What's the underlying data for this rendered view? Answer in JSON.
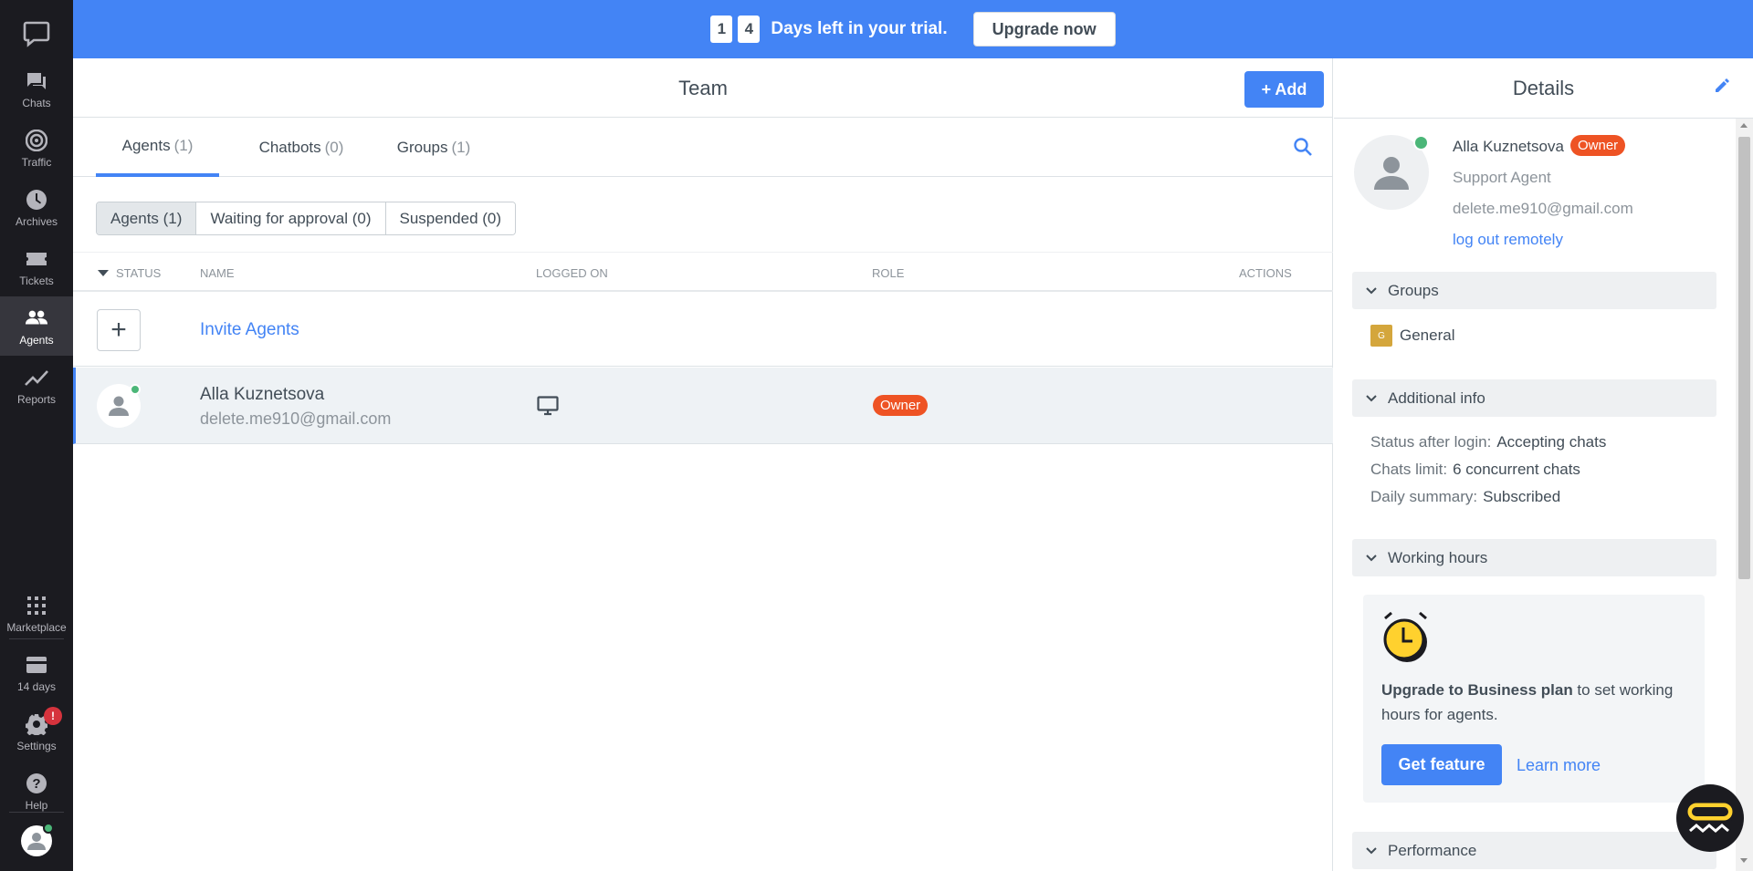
{
  "nav": {
    "items": [
      {
        "label": "Chats",
        "icon": "chat-icon"
      },
      {
        "label": "Traffic",
        "icon": "traffic-icon"
      },
      {
        "label": "Archives",
        "icon": "clock-icon"
      },
      {
        "label": "Tickets",
        "icon": "ticket-icon"
      },
      {
        "label": "Agents",
        "icon": "agents-icon",
        "active": true
      },
      {
        "label": "Reports",
        "icon": "chart-icon"
      }
    ],
    "bottom": [
      {
        "label": "Marketplace",
        "icon": "grid-icon"
      },
      {
        "label": "14 days",
        "icon": "card-icon"
      },
      {
        "label": "Settings",
        "icon": "gear-icon",
        "badge": "!"
      },
      {
        "label": "Help",
        "icon": "help-icon"
      }
    ]
  },
  "banner": {
    "digits": [
      "1",
      "4"
    ],
    "text": "Days left in your trial.",
    "button": "Upgrade now"
  },
  "main": {
    "title": "Team",
    "add_button": "+ Add",
    "tabs": [
      {
        "label": "Agents",
        "count": "(1)",
        "active": true
      },
      {
        "label": "Chatbots",
        "count": "(0)"
      },
      {
        "label": "Groups",
        "count": "(1)"
      }
    ],
    "segments": [
      "Agents (1)",
      "Waiting for approval (0)",
      "Suspended (0)"
    ],
    "columns": [
      "Status",
      "Name",
      "Logged on",
      "Role",
      "Actions"
    ],
    "invite_label": "Invite Agents",
    "agent": {
      "name": "Alla Kuznetsova",
      "email": "delete.me910@gmail.com",
      "role": "Owner"
    }
  },
  "details": {
    "title": "Details",
    "name": "Alla Kuznetsova",
    "badge": "Owner",
    "role": "Support Agent",
    "email": "delete.me910@gmail.com",
    "logout": "log out remotely",
    "sections": {
      "groups": "Groups",
      "additional": "Additional info",
      "working_hours": "Working hours",
      "performance": "Performance"
    },
    "group": {
      "initial": "G",
      "name": "General"
    },
    "info": [
      {
        "key": "Status after login:",
        "value": "Accepting chats"
      },
      {
        "key": "Chats limit:",
        "value": "6 concurrent chats"
      },
      {
        "key": "Daily summary:",
        "value": "Subscribed"
      }
    ],
    "wh": {
      "bold": "Upgrade to Business plan",
      "rest": " to set working hours for agents.",
      "get_feature": "Get feature",
      "learn_more": "Learn more"
    }
  },
  "colors": {
    "accent": "#4384f5",
    "owner": "#ee5324",
    "online": "#4bb678",
    "nav_bg": "#1b1b20"
  }
}
